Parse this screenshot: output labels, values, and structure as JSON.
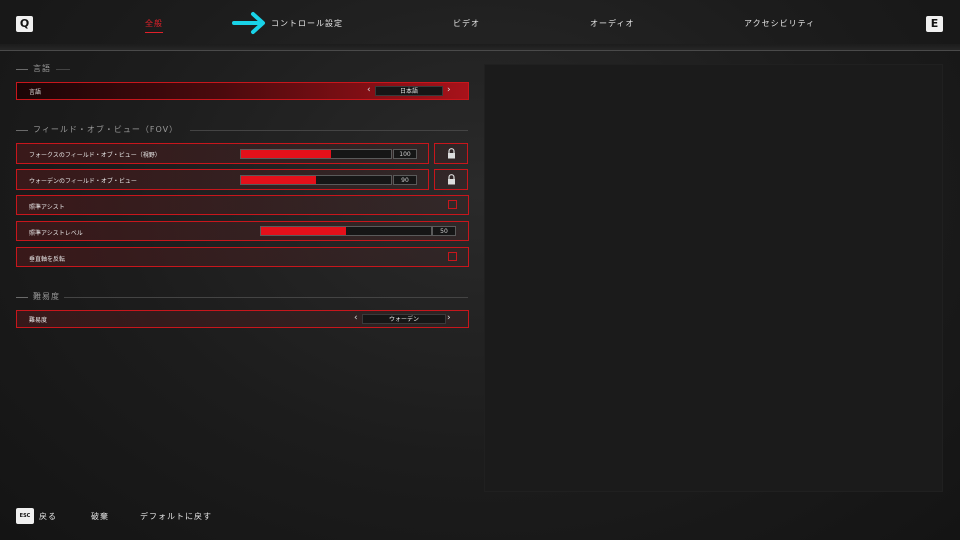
{
  "nav": {
    "key_left": "Q",
    "key_right": "E",
    "tabs": [
      {
        "label": "全般"
      },
      {
        "label": "コントロール設定"
      },
      {
        "label": "ビデオ"
      },
      {
        "label": "オーディオ"
      },
      {
        "label": "アクセシビリティ"
      }
    ],
    "annotation_arrow_color": "#19d3e8"
  },
  "sections": {
    "language": "言語",
    "fov": "フィールド・オブ・ビュー（FOV）",
    "difficulty": "難易度"
  },
  "settings": {
    "language": {
      "label": "言語",
      "value": "日本語"
    },
    "forks_fov": {
      "label": "フォークスのフィールド・オブ・ビュー（視野）",
      "value": "100",
      "fraction": 0.6
    },
    "warden_fov": {
      "label": "ウォーデンのフィールド・オブ・ビュー",
      "value": "90",
      "fraction": 0.5
    },
    "aim_assist": {
      "label": "照準アシスト",
      "checked": false
    },
    "aim_assist_level": {
      "label": "照準アシストレベル",
      "value": "50",
      "fraction": 0.5
    },
    "invert_vertical": {
      "label": "垂直軸を反転",
      "checked": false
    },
    "difficulty": {
      "label": "難易度",
      "value": "ウォーデン"
    }
  },
  "footer": {
    "esc_key": "ESC",
    "back": "戻る",
    "discard": "破棄",
    "reset_default": "デフォルトに戻す"
  },
  "colors": {
    "accent": "#e0202a",
    "slider_fill": "#e4101a"
  }
}
